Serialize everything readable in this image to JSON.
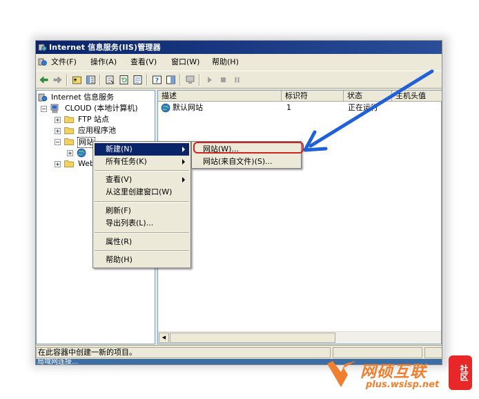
{
  "window": {
    "title": "Internet 信息服务(IIS)管理器"
  },
  "menubar": {
    "items": [
      "文件(F)",
      "操作(A)",
      "查看(V)",
      "窗口(W)",
      "帮助(H)"
    ]
  },
  "tree": {
    "root": "Internet 信息服务",
    "computer": "CLOUD (本地计算机)",
    "ftp": "FTP 站点",
    "apppools": "应用程序池",
    "websites": "网站",
    "webext": "Web"
  },
  "list": {
    "columns": [
      "描述",
      "标识符",
      "状态",
      "主机头值"
    ],
    "rows": [
      {
        "description": "默认网站",
        "id": "1",
        "status": "正在运行",
        "host": ""
      }
    ]
  },
  "context_menu": {
    "items": [
      "新建(N)",
      "所有任务(K)",
      "查看(V)",
      "从这里创建窗口(W)",
      "刷新(F)",
      "导出列表(L)...",
      "属性(R)",
      "帮助(H)"
    ]
  },
  "submenu": {
    "items": [
      "网站(W)...",
      "网站(来自文件)(S)..."
    ]
  },
  "statusbar": {
    "text": "在此容器中创建一新的项目。"
  },
  "taskbar": {
    "text": "局域网连接..."
  },
  "watermark": {
    "name": "网硕互联",
    "url": "plus.wsisp.net",
    "seal": "社区"
  },
  "colors": {
    "title_bar": "#0a246a",
    "menu_highlight": "#0a246a",
    "highlight_box": "#d42020",
    "arrow": "#2060d8",
    "brand": "#f08030"
  }
}
